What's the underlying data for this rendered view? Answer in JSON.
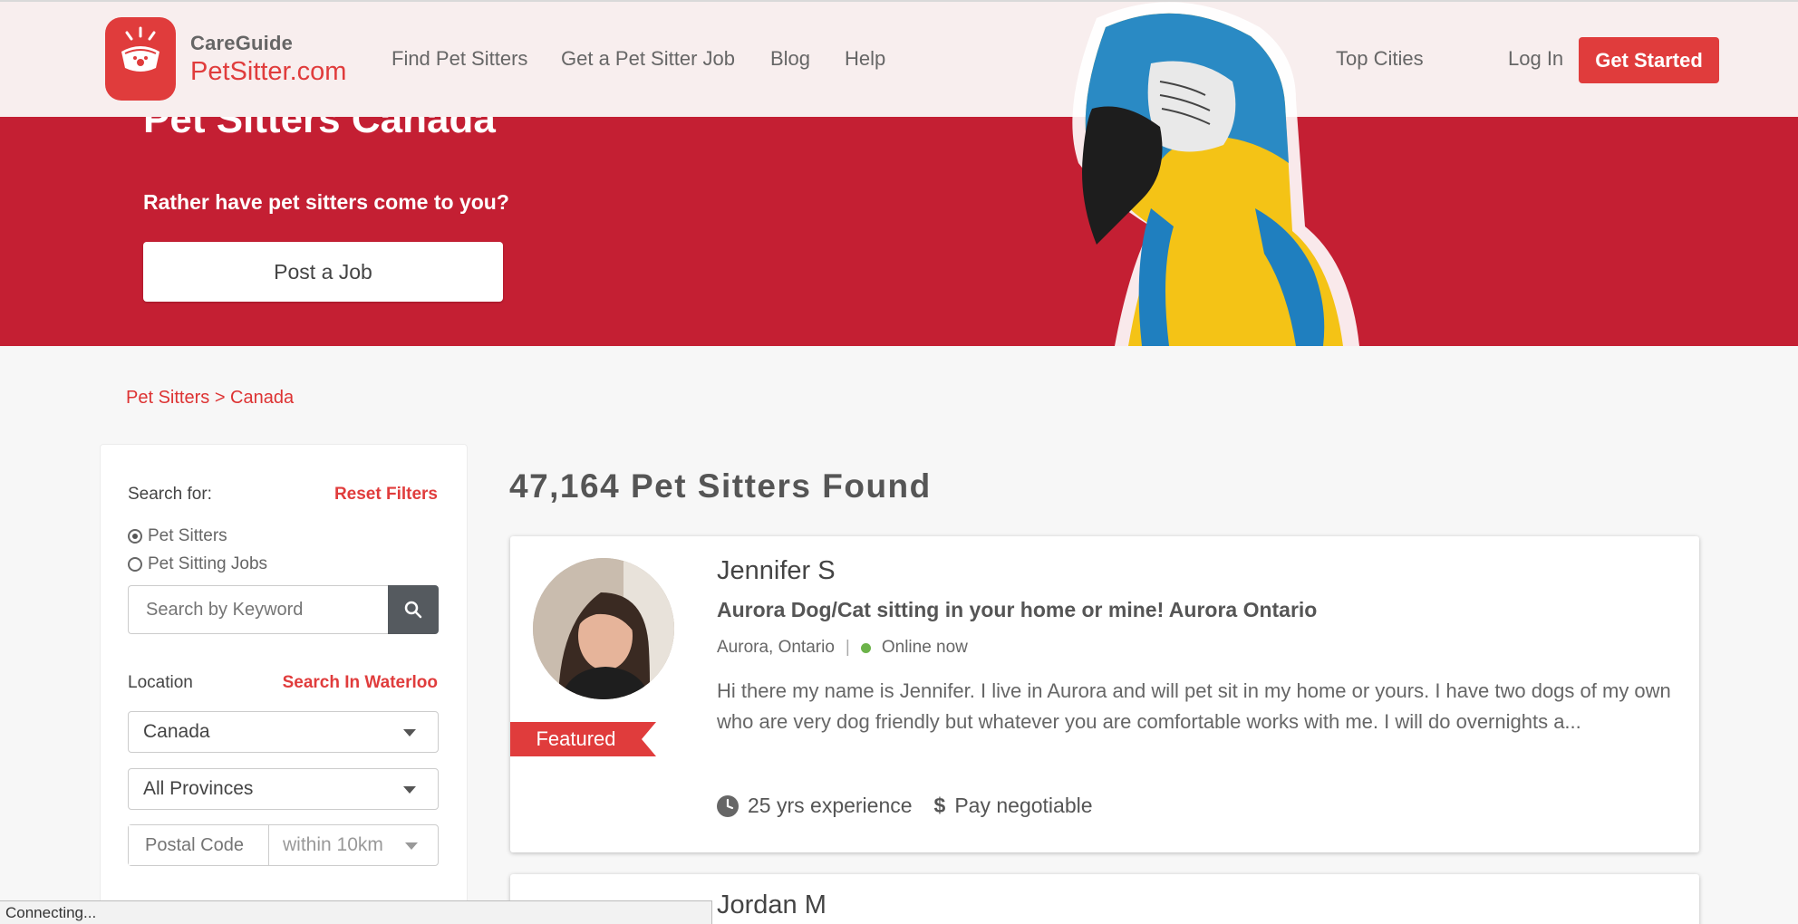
{
  "header": {
    "logo_small": "CareGuide",
    "logo_big": "PetSitter.com",
    "nav": [
      "Find Pet Sitters",
      "Get a Pet Sitter Job",
      "Blog",
      "Help"
    ],
    "top_cities": "Top Cities",
    "login": "Log In",
    "get_started": "Get Started"
  },
  "hero": {
    "title": "Pet Sitters Canada",
    "subtitle": "Rather have pet sitters come to you?",
    "post_job": "Post a Job"
  },
  "breadcrumb": "Pet Sitters > Canada",
  "sidebar": {
    "search_for": "Search for:",
    "reset": "Reset Filters",
    "options": [
      "Pet Sitters",
      "Pet Sitting Jobs"
    ],
    "keyword_placeholder": "Search by Keyword",
    "location": "Location",
    "search_in": "Search In Waterloo",
    "country": "Canada",
    "province": "All Provinces",
    "postal_placeholder": "Postal Code",
    "within": "within 10km"
  },
  "results": {
    "title": "47,164 Pet Sitters Found",
    "cards": [
      {
        "badge": "Featured",
        "name": "Jennifer S",
        "headline": "Aurora Dog/Cat sitting in your home or mine! Aurora Ontario",
        "location": "Aurora, Ontario",
        "separator": "|",
        "status": "Online now",
        "bio": "Hi there my name is Jennifer. I live in Aurora and will pet sit in my home or yours. I have two dogs of my own who are very dog friendly but whatever you are comfortable works with me. I will do overnights a...",
        "experience": "25 yrs experience",
        "pay": "Pay negotiable"
      },
      {
        "name": "Jordan M"
      }
    ]
  },
  "status_bar": "Connecting...",
  "colors": {
    "brand_red": "#e03c3c",
    "hero_red": "#c41f33",
    "online_green": "#6cb34a"
  }
}
